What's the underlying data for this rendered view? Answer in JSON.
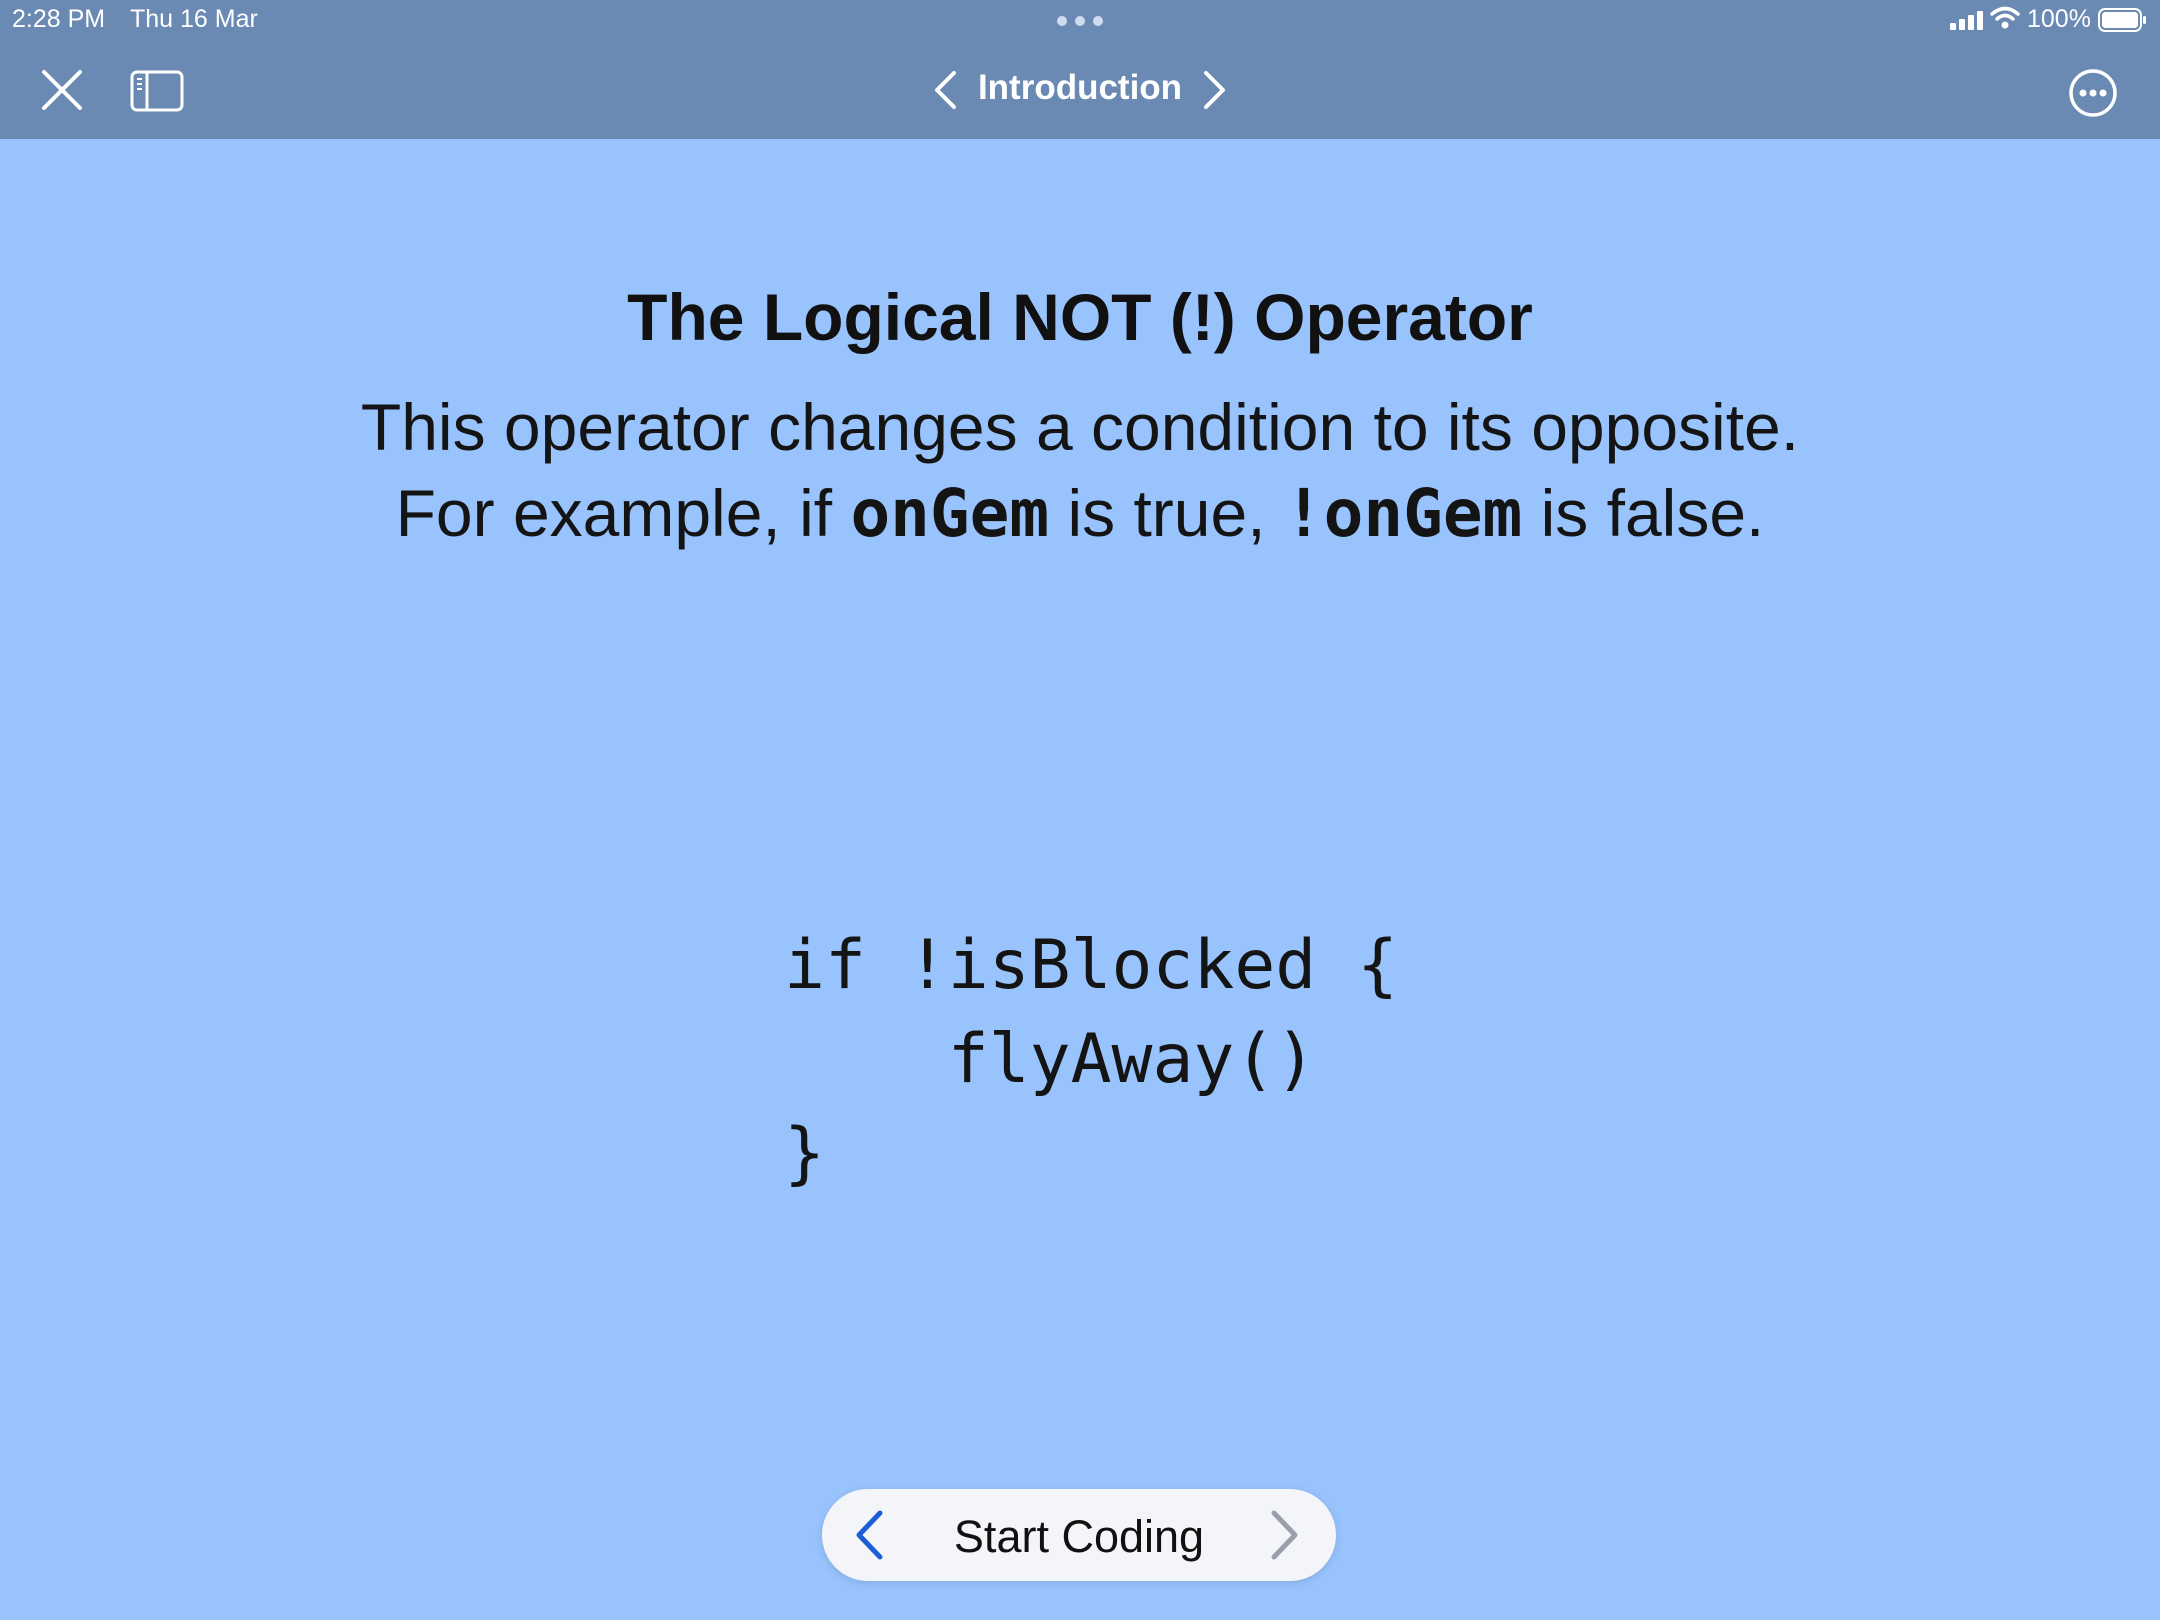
{
  "status_bar": {
    "time": "2:28 PM",
    "date": "Thu 16 Mar",
    "battery": "100%"
  },
  "nav": {
    "title": "Introduction",
    "icons": {
      "close": "close-icon",
      "sidebar": "sidebar-icon",
      "prev": "chevron-left-icon",
      "next": "chevron-right-icon",
      "more": "ellipsis-circle-icon"
    }
  },
  "content": {
    "heading": "The Logical NOT (!) Operator",
    "line1": "This operator changes a condition to its opposite.",
    "line2_part1": "For example, if ",
    "line2_code1": "onGem",
    "line2_part2": " is true, ",
    "line2_code2": "!onGem",
    "line2_part3": " is false.",
    "code": [
      "if !isBlocked {",
      "    flyAway()",
      "}"
    ]
  },
  "bottom": {
    "label": "Start Coding"
  },
  "colors": {
    "page_background": "#98c3fd",
    "nav_background": "#6b8ab3",
    "accent_blue": "#1b5fd6",
    "pill_background": "#f4f5f9"
  }
}
